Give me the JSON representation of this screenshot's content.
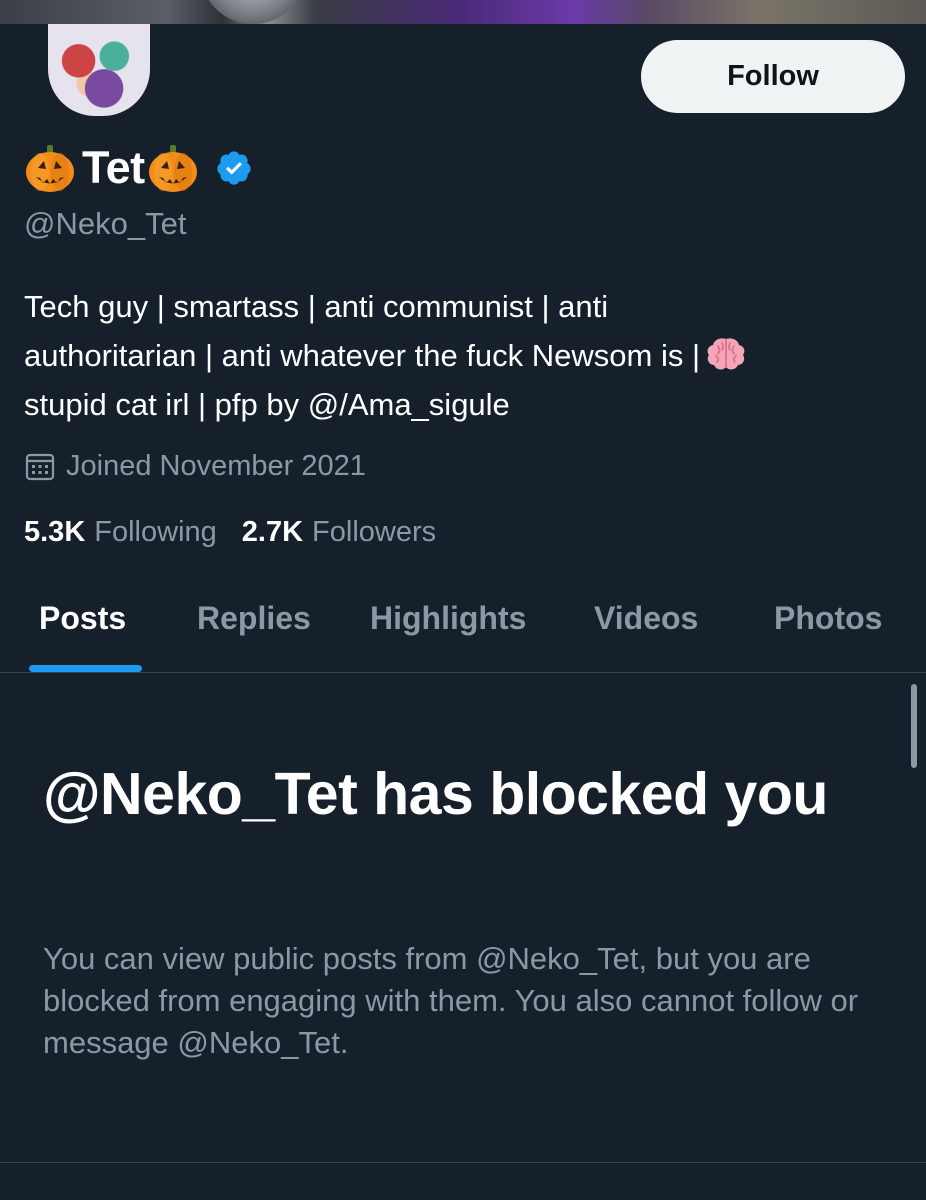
{
  "profile": {
    "display_name": "Tet",
    "handle": "@Neko_Tet",
    "bio_lines": [
      "Tech guy | smartass | anti communist | anti",
      "authoritarian | anti whatever the fuck Newsom is |",
      "stupid cat irl | pfp by @/Ama_sigule"
    ],
    "name_decoration_icon": "jack-o-lantern-icon",
    "verified_icon": "verified-badge-icon",
    "bio_icon": "brain-icon",
    "joined": "Joined November 2021",
    "following_count": "5.3K",
    "following_label": "Following",
    "followers_count": "2.7K",
    "followers_label": "Followers"
  },
  "actions": {
    "follow_label": "Follow"
  },
  "tabs": [
    {
      "label": "Posts",
      "active": true
    },
    {
      "label": "Replies",
      "active": false
    },
    {
      "label": "Highlights",
      "active": false
    },
    {
      "label": "Videos",
      "active": false
    },
    {
      "label": "Photos",
      "active": false
    }
  ],
  "blocked": {
    "title": "@Neko_Tet has blocked you",
    "message": "You can view public posts from @Neko_Tet, but you are blocked from engaging with them. You also cannot follow or message @Neko_Tet."
  },
  "colors": {
    "background": "#15202b",
    "accent": "#1d9bf0",
    "secondary_text": "#8b98a5",
    "button_bg": "#eff3f4"
  }
}
